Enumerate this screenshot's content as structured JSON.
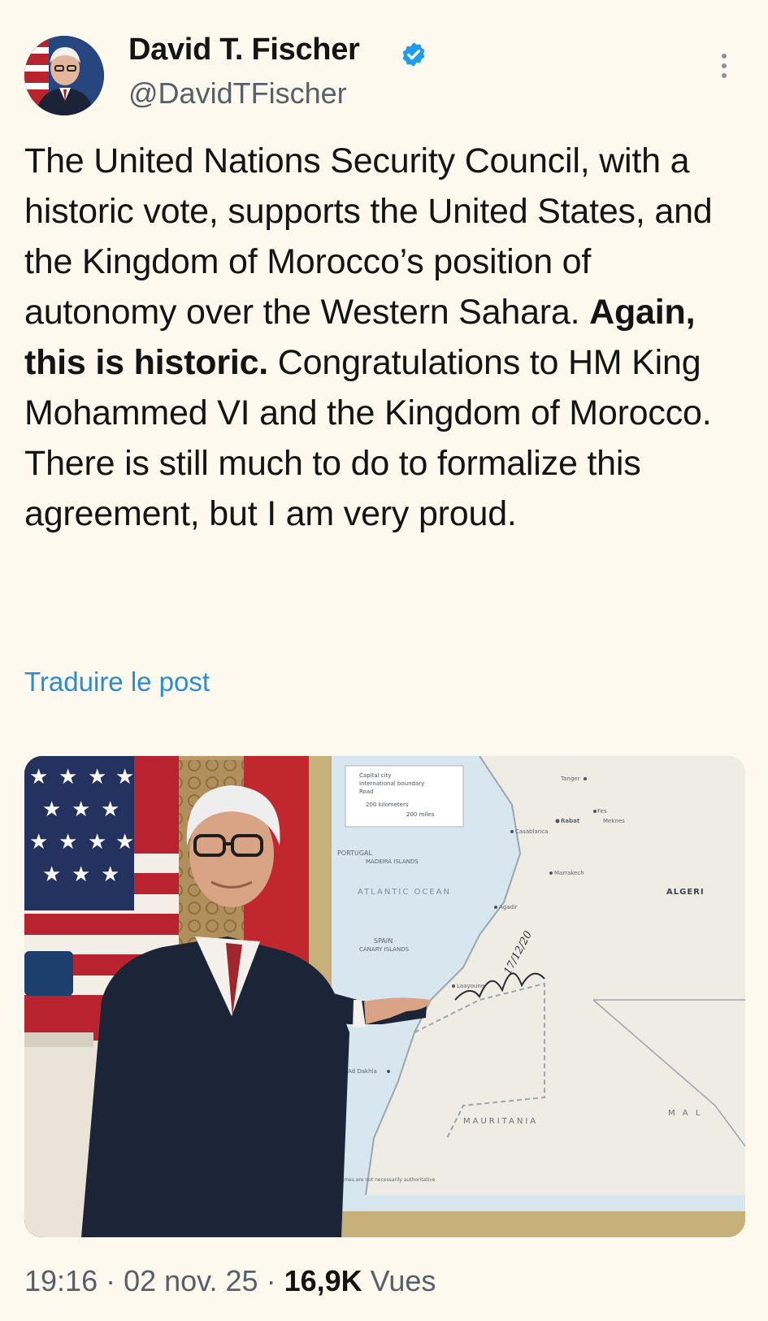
{
  "author": {
    "name": "David T. Fischer",
    "handle": "@DavidTFischer",
    "verified": true,
    "verified_color": "#1d9bf0"
  },
  "tweet": {
    "text_part1": "The United Nations Security Council, with a historic vote, supports the United States, and the Kingdom of Morocco’s position of autonomy over the Western Sahara. ",
    "text_bold": "Again, this is historic.",
    "text_part2": " Congratulations to HM King Mohammed VI and the Kingdom of Morocco. There is still much to do to formalize this agreement, but I am very proud.",
    "translate_label": "Traduire le post"
  },
  "media": {
    "alt_subject": "photo",
    "map_labels": {
      "legend_capital": "Capital city",
      "legend_boundary": "International boundary",
      "legend_road": "Road",
      "legend_scale_km": "200 kilometers",
      "legend_scale_mi": "200 miles",
      "portugal": "PORTUGAL",
      "madeira": "MADEIRA ISLANDS",
      "atlantic": "ATLANTIC OCEAN",
      "spain": "SPAIN",
      "canary": "CANARY ISLANDS",
      "algeria": "ALGERI",
      "mauritania": "MAURITANIA",
      "mali": "M A L",
      "rabat": "Rabat",
      "casablanca": "Casablanca",
      "tanger": "Tanger",
      "fes": "Fes",
      "meknes": "Meknes",
      "marrakech": "Marrakech",
      "agadir": "Agadir",
      "laayoune": "Laayoune",
      "dakhla": "Ad Dakhla",
      "footnote": "Names are not necessarily authoritative"
    },
    "signature": "17/12/20"
  },
  "meta": {
    "time": "19:16",
    "separator1": " · ",
    "date": "02 nov. 25",
    "separator2": " · ",
    "views_count": "16,9K",
    "views_label": " Vues"
  },
  "colors": {
    "background": "#fdf9ee",
    "text": "#141414",
    "secondary": "#56606a",
    "link": "#2a8bd6"
  }
}
